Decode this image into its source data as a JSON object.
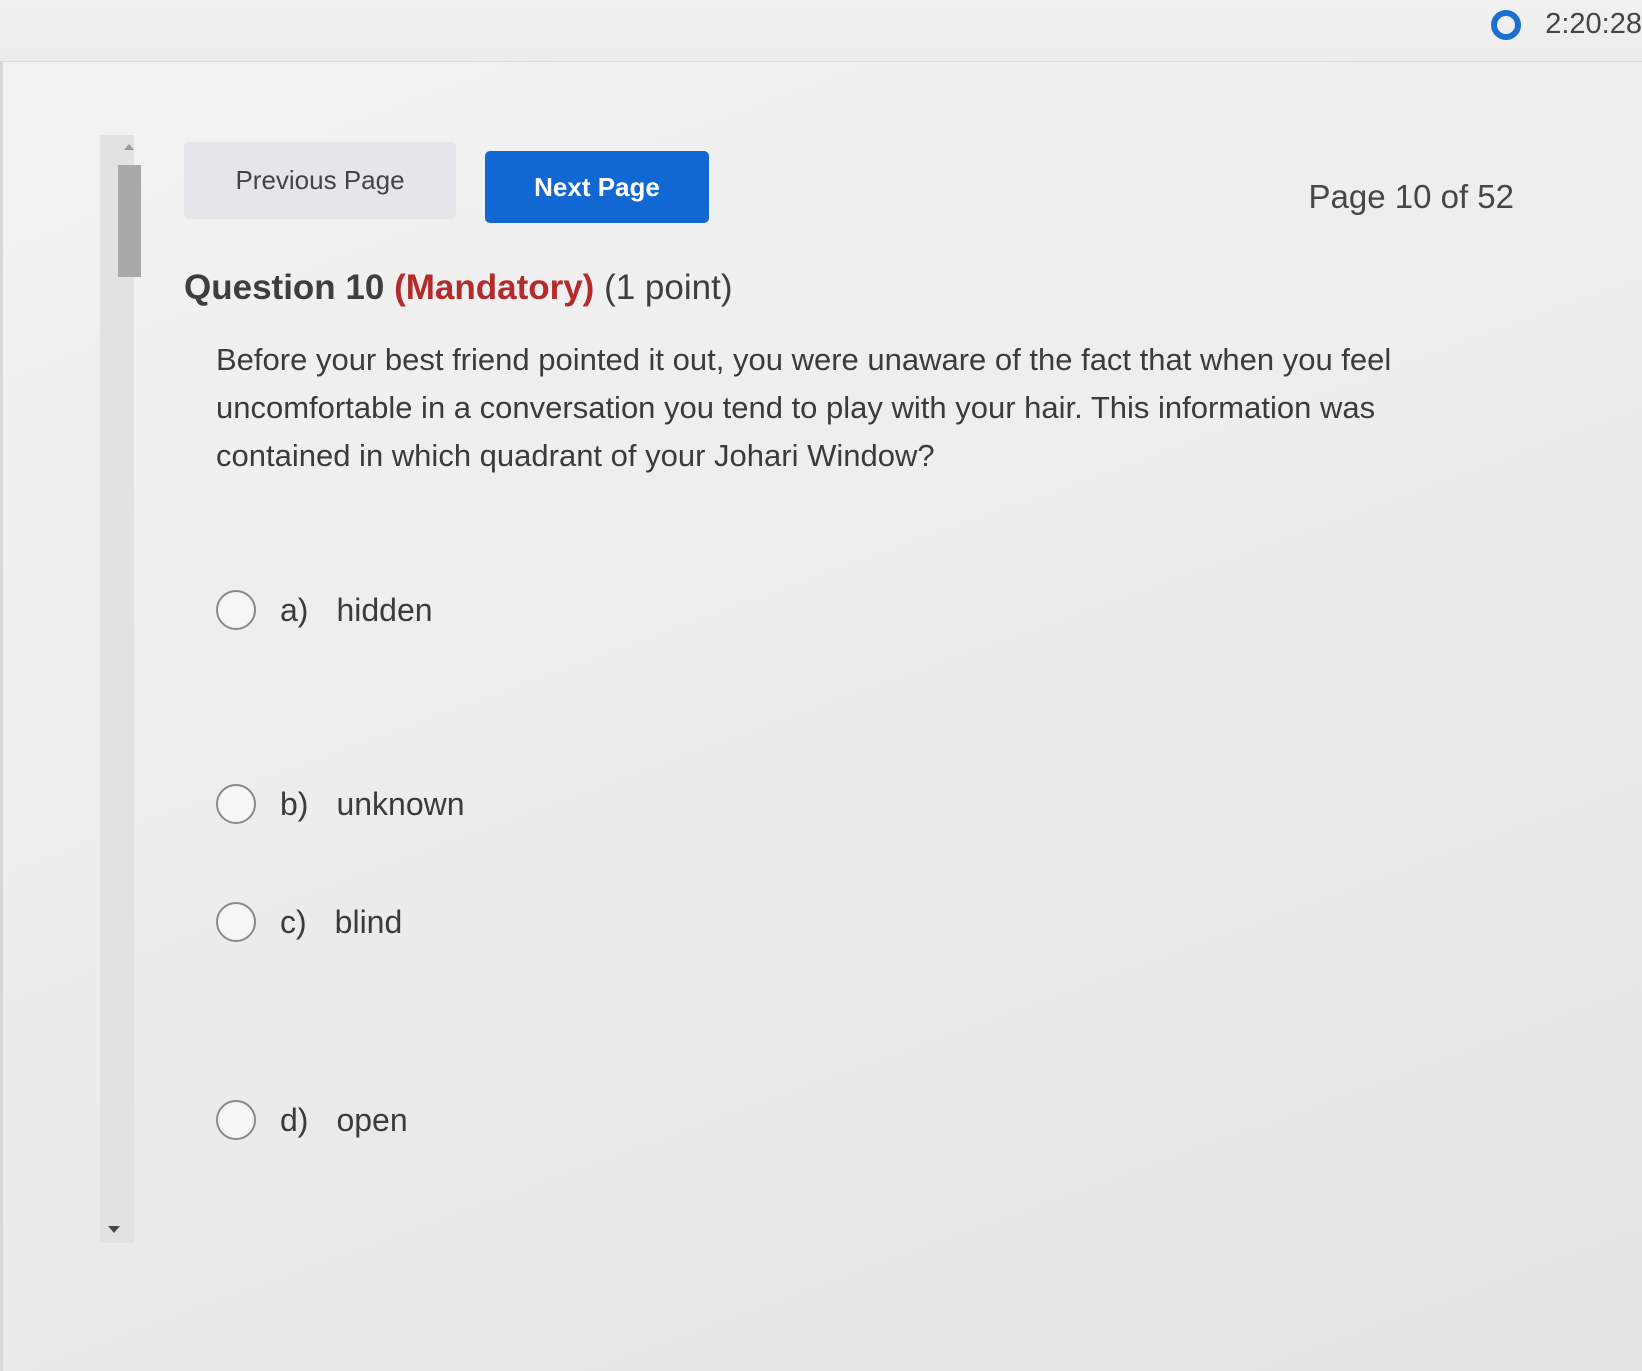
{
  "timer": {
    "icon": "timer-circle-icon",
    "remaining": "2:20:28",
    "accent_color": "#1a6fd1"
  },
  "nav": {
    "previous_label": "Previous Page",
    "next_label": "Next Page",
    "next_color": "#1268d2",
    "page_indicator": "Page 10 of 52"
  },
  "question": {
    "title": "Question 10",
    "mandatory": "(Mandatory)",
    "mandatory_color": "#b32b2b",
    "points": "(1 point)",
    "text": "Before your best friend pointed it out, you were unaware of the fact that when you feel uncomfortable in a conversation you tend to play with your hair.  This information was contained in which quadrant of your Johari Window?",
    "options": [
      {
        "letter": "a)",
        "label": "hidden"
      },
      {
        "letter": "b)",
        "label": "unknown"
      },
      {
        "letter": "c)",
        "label": "blind"
      },
      {
        "letter": "d)",
        "label": "open"
      }
    ]
  }
}
